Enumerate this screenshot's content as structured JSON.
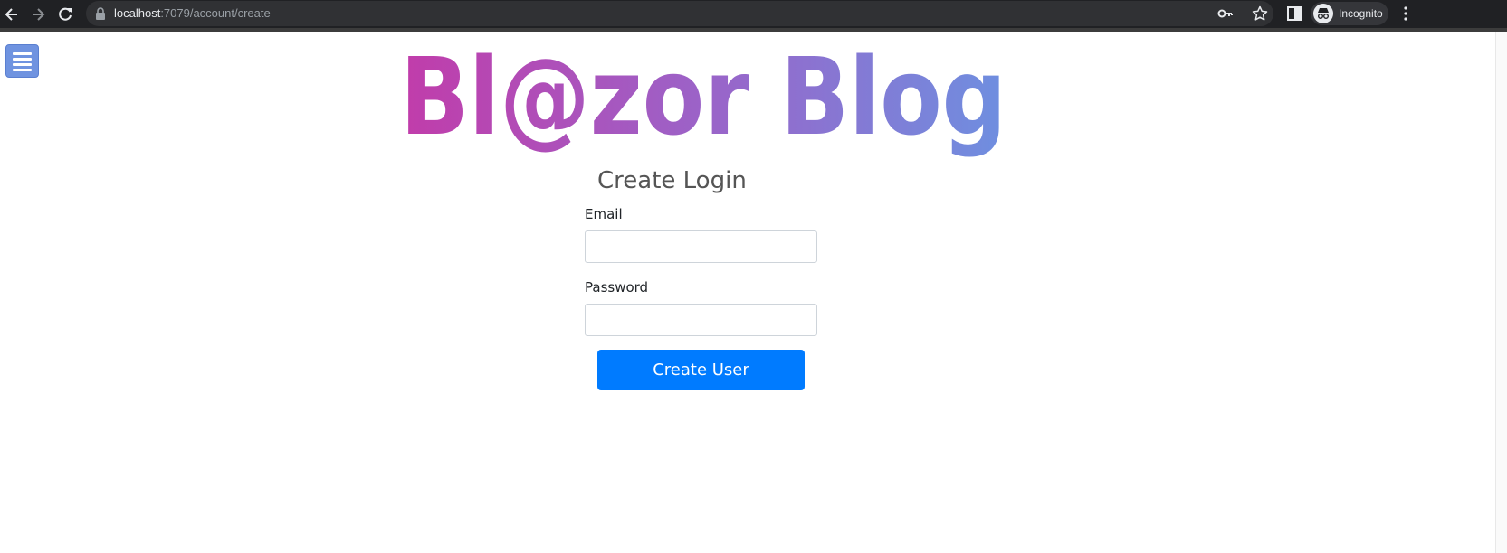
{
  "browser": {
    "url_host": "localhost",
    "url_path": ":7079/account/create",
    "profile_label": "Incognito"
  },
  "page": {
    "logo_text": "Bl@zor Blog",
    "form": {
      "title": "Create Login",
      "email_label": "Email",
      "email_value": "",
      "password_label": "Password",
      "password_value": "",
      "submit_label": "Create User"
    }
  },
  "colors": {
    "logo_gradient_start": "#c13caa",
    "logo_gradient_mid": "#9b63c8",
    "logo_gradient_end": "#6e8fe0",
    "primary_button": "#007bff",
    "menu_button": "#6f93e0"
  },
  "icons": {
    "back": "arrow-left",
    "forward": "arrow-right",
    "reload": "reload",
    "lock": "lock",
    "password_key": "key",
    "bookmark": "star",
    "side_panel": "side-panel",
    "incognito": "incognito",
    "menu": "kebab-menu",
    "hamburger": "hamburger"
  }
}
